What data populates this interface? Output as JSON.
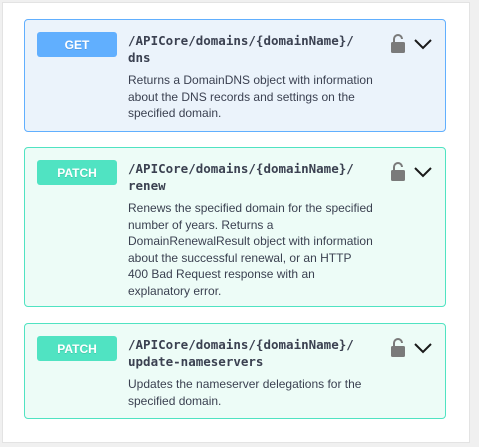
{
  "operations": [
    {
      "method": "GET",
      "path_line1": "/APICore/domains/{domainName}/",
      "path_line2": "dns",
      "description": "Returns a DomainDNS object with information about the DNS records and settings on the specified domain."
    },
    {
      "method": "PATCH",
      "path_line1": "/APICore/domains/{domainName}/",
      "path_line2": "renew",
      "description": "Renews the specified domain for the specified number of years. Returns a DomainRenewalResult object with information about the successful renewal, or an HTTP 400 Bad Request response with an explanatory error."
    },
    {
      "method": "PATCH",
      "path_line1": "/APICore/domains/{domainName}/",
      "path_line2": "update-nameservers",
      "description": "Updates the nameserver delegations for the specified domain."
    }
  ],
  "icons": {
    "lock": "lock-open-icon",
    "expand": "chevron-down-icon"
  },
  "colors": {
    "get": "#61affe",
    "get_bg": "#ebf3fb",
    "patch": "#50e3c2",
    "patch_bg": "#edfcf7",
    "text": "#3b4151",
    "icon": "#7a7a7a"
  }
}
